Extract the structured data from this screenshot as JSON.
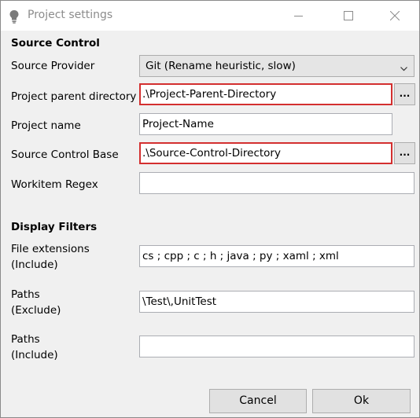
{
  "window": {
    "title": "Project settings",
    "icon": "lightbulb-icon",
    "controls": {
      "minimize": "minimize-icon",
      "maximize": "maximize-icon",
      "close": "close-icon"
    }
  },
  "source_control": {
    "heading": "Source Control",
    "provider": {
      "label": "Source Provider",
      "value": "Git (Rename heuristic, slow)"
    },
    "parent_dir": {
      "label": "Project parent directory",
      "value": ".\\Project-Parent-Directory",
      "browse": "..."
    },
    "project_name": {
      "label": "Project name",
      "value": "Project-Name"
    },
    "base": {
      "label": "Source Control Base",
      "value": ".\\Source-Control-Directory",
      "browse": "..."
    },
    "workitem": {
      "label": "Workitem Regex",
      "value": ""
    }
  },
  "display_filters": {
    "heading": "Display Filters",
    "extensions": {
      "label_line1": "File extensions",
      "label_line2": "(Include)",
      "value": "cs ; cpp ; c ; h ; java ; py ; xaml ; xml"
    },
    "paths_exclude": {
      "label_line1": "Paths",
      "label_line2": "(Exclude)",
      "value": "\\Test\\,UnitTest"
    },
    "paths_include": {
      "label_line1": "Paths",
      "label_line2": "(Include)",
      "value": ""
    }
  },
  "footer": {
    "cancel": "Cancel",
    "ok": "Ok"
  },
  "colors": {
    "highlight": "#d32f2f",
    "title_text": "#8c8c8c"
  }
}
